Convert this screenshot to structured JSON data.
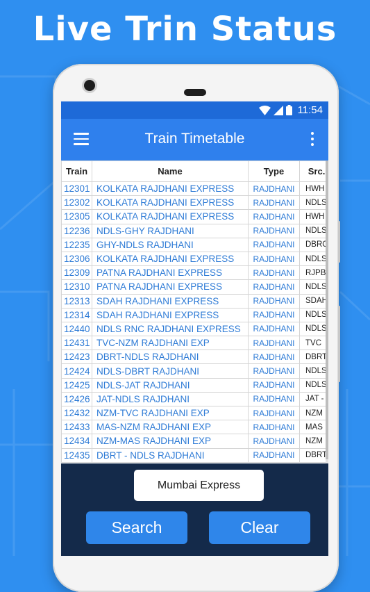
{
  "promo": {
    "headline": "Live Trin Status"
  },
  "status_bar": {
    "time": "11:54",
    "icons": [
      "wifi-icon",
      "signal-icon",
      "battery-icon"
    ]
  },
  "app_bar": {
    "title": "Train Timetable",
    "menu_icon": "hamburger-icon",
    "overflow_icon": "more-vert-icon"
  },
  "table": {
    "headers": [
      "Train",
      "Name",
      "Type",
      "Src. -"
    ],
    "rows": [
      [
        "12301",
        "KOLKATA RAJDHANI EXPRESS",
        "RAJDHANI",
        "HWH"
      ],
      [
        "12302",
        "KOLKATA RAJDHANI EXPRESS",
        "RAJDHANI",
        "NDLS"
      ],
      [
        "12305",
        "KOLKATA RAJDHANI EXPRESS",
        "RAJDHANI",
        "HWH"
      ],
      [
        "12236",
        "NDLS-GHY RAJDHANI",
        "RAJDHANI",
        "NDLS"
      ],
      [
        "12235",
        "GHY-NDLS RAJDHANI",
        "RAJDHANI",
        "DBRG"
      ],
      [
        "12306",
        "KOLKATA RAJDHANI EXPRESS",
        "RAJDHANI",
        "NDLS"
      ],
      [
        "12309",
        "PATNA RAJDHANI EXPRESS",
        "RAJDHANI",
        "RJPB"
      ],
      [
        "12310",
        "PATNA RAJDHANI EXPRESS",
        "RAJDHANI",
        "NDLS"
      ],
      [
        "12313",
        "SDAH RAJDHANI EXPRESS",
        "RAJDHANI",
        "SDAH"
      ],
      [
        "12314",
        "SDAH RAJDHANI EXPRESS",
        "RAJDHANI",
        "NDLS"
      ],
      [
        "12440",
        "NDLS RNC RAJDHANI EXPRESS",
        "RAJDHANI",
        "NDLS"
      ],
      [
        "12431",
        "TVC-NZM RAJDHANI EXP",
        "RAJDHANI",
        "TVC"
      ],
      [
        "12423",
        "DBRT-NDLS RAJDHANI",
        "RAJDHANI",
        "DBRT"
      ],
      [
        "12424",
        "NDLS-DBRT RAJDHANI",
        "RAJDHANI",
        "NDLS"
      ],
      [
        "12425",
        "NDLS-JAT RAJDHANI",
        "RAJDHANI",
        "NDLS"
      ],
      [
        "12426",
        "JAT-NDLS RAJDHANI",
        "RAJDHANI",
        "JAT -"
      ],
      [
        "12432",
        "NZM-TVC RAJDHANI EXP",
        "RAJDHANI",
        "NZM"
      ],
      [
        "12433",
        "MAS-NZM RAJDHANI EXP",
        "RAJDHANI",
        "MAS"
      ],
      [
        "12434",
        "NZM-MAS RAJDHANI EXP",
        "RAJDHANI",
        "NZM"
      ],
      [
        "12435",
        "DBRT - NDLS RAJDHANI",
        "RAJDHANI",
        "DBRT"
      ]
    ]
  },
  "search_panel": {
    "input_value": "Mumbai Express",
    "search_label": "Search",
    "clear_label": "Clear"
  },
  "colors": {
    "background": "#2f8ff0",
    "app_bar": "#2f80ed",
    "status_bar": "#1e6ad8",
    "panel": "#142a4a",
    "button": "#2f86ea",
    "link_text": "#2e7bd6"
  }
}
